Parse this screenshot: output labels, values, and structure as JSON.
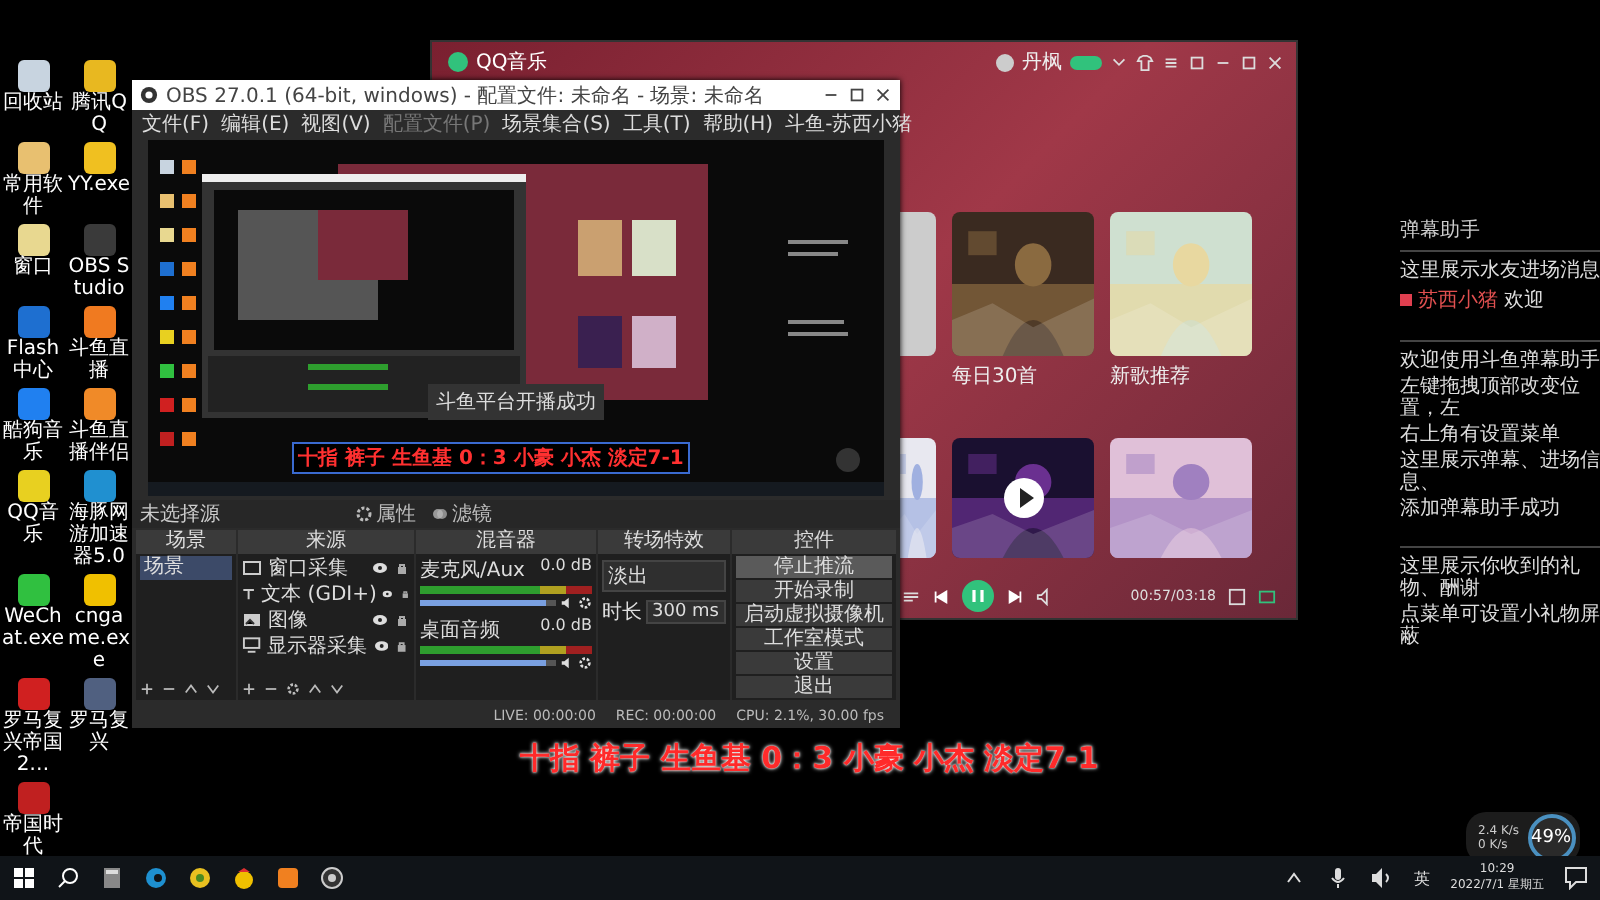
{
  "desktop": {
    "icons": [
      {
        "label": "回收站",
        "color": "#c8d4e0"
      },
      {
        "label": "腾讯QQ",
        "color": "#e8b820"
      },
      {
        "label": "常用软件",
        "color": "#e8c070"
      },
      {
        "label": "YY.exe",
        "color": "#f0c020"
      },
      {
        "label": "窗口",
        "color": "#e8d890"
      },
      {
        "label": "OBS Studio",
        "color": "#3a3a3a"
      },
      {
        "label": "Flash中心",
        "color": "#1e6fd0"
      },
      {
        "label": "斗鱼直播",
        "color": "#f07a20"
      },
      {
        "label": "酷狗音乐",
        "color": "#2080f0"
      },
      {
        "label": "斗鱼直播伴侣",
        "color": "#f08a28"
      },
      {
        "label": "QQ音乐",
        "color": "#e8d020"
      },
      {
        "label": "海豚网游加速器5.0",
        "color": "#2090d0"
      },
      {
        "label": "WeChat.exe",
        "color": "#30c040"
      },
      {
        "label": "cngame.exe",
        "color": "#f0c000"
      },
      {
        "label": "罗马复兴帝国2…",
        "color": "#d02020"
      },
      {
        "label": "罗马复兴",
        "color": "#506080"
      },
      {
        "label": "帝国时代",
        "color": "#c02020"
      }
    ],
    "caption": "十指 裤子 生鱼基 0：3 小豪 小杰 淡定7-1"
  },
  "obs": {
    "title": "OBS 27.0.1 (64-bit, windows) - 配置文件: 未命名 - 场景: 未命名",
    "menu": [
      {
        "label": "文件(F)",
        "disabled": false
      },
      {
        "label": "编辑(E)",
        "disabled": false
      },
      {
        "label": "视图(V)",
        "disabled": false
      },
      {
        "label": "配置文件(P)",
        "disabled": true
      },
      {
        "label": "场景集合(S)",
        "disabled": false
      },
      {
        "label": "工具(T)",
        "disabled": false
      },
      {
        "label": "帮助(H)",
        "disabled": false
      },
      {
        "label": "斗鱼-苏西小猪",
        "disabled": false
      }
    ],
    "preview": {
      "caption": "十指 裤子 生鱼基 0：3 小豪 小杰 淡定7-1",
      "toast": "斗鱼平台开播成功"
    },
    "source_bar": {
      "label": "未选择源",
      "buttons": [
        {
          "label": "属性",
          "kind": "properties"
        },
        {
          "label": "滤镜",
          "kind": "filters"
        }
      ]
    },
    "scenes": {
      "title": "场景",
      "items": [
        {
          "label": "场景",
          "selected": true
        }
      ]
    },
    "sources": {
      "title": "来源",
      "items": [
        {
          "label": "窗口采集",
          "kind": "window"
        },
        {
          "label": "文本 (GDI+)",
          "kind": "text"
        },
        {
          "label": "图像"
        },
        {
          "label": "显示器采集",
          "kind": "monitor"
        }
      ]
    },
    "mixer": {
      "title": "混音器",
      "channels": [
        {
          "name": "麦克风/Aux",
          "reading": "0.0 dB",
          "level": 0.92
        },
        {
          "name": "桌面音频",
          "reading": "0.0 dB",
          "level": 0.92
        }
      ]
    },
    "transitions": {
      "title": "转场特效",
      "type": "淡出",
      "duration_label": "时长",
      "duration": "300 ms"
    },
    "controls": {
      "title": "控件",
      "buttons": [
        {
          "label": "停止推流",
          "selected": true
        },
        {
          "label": "开始录制",
          "selected": false
        },
        {
          "label": "启动虚拟摄像机",
          "selected": false
        },
        {
          "label": "工作室模式",
          "selected": false
        },
        {
          "label": "设置",
          "selected": false
        },
        {
          "label": "退出",
          "selected": false
        }
      ]
    },
    "status": {
      "live": "LIVE: 00:00:00",
      "rec": "REC: 00:00:00",
      "cpu": "CPU: 2.1%, 30.00 fps"
    }
  },
  "qqmusic": {
    "title": "QQ音乐",
    "user": "丹枫",
    "cards": [
      {
        "label": "每日30首",
        "kind": "daily"
      },
      {
        "label": "新歌推荐",
        "kind": "new"
      }
    ],
    "row2": [
      {
        "kind": "anime"
      },
      {
        "kind": "city"
      },
      {
        "kind": "portrait"
      }
    ],
    "player": {
      "playing": true,
      "time": "00:57/03:18"
    }
  },
  "danmu_panel": {
    "title": "弹幕助手",
    "sections": [
      [
        {
          "kind": "note",
          "text": "这里展示水友进场消息"
        },
        {
          "kind": "entry",
          "user": "苏西小猪",
          "text": "欢迎"
        }
      ],
      [
        {
          "kind": "note",
          "text": "欢迎使用斗鱼弹幕助手"
        },
        {
          "kind": "note",
          "text": "左键拖拽顶部改变位置，左"
        },
        {
          "kind": "note",
          "text": "右上角有设置菜单"
        },
        {
          "kind": "note",
          "text": "这里展示弹幕、进场信息、"
        },
        {
          "kind": "note",
          "text": "添加弹幕助手成功"
        }
      ],
      [
        {
          "kind": "note",
          "text": "这里展示你收到的礼物、酬谢"
        },
        {
          "kind": "note",
          "text": "点菜单可设置小礼物屏蔽"
        }
      ]
    ]
  },
  "net_widget": {
    "up": "2.4 K/s",
    "down": "0 K/s",
    "percent": "49%"
  },
  "taskbar": {
    "ime": "英",
    "time": "10:29",
    "date": "2022/7/1 星期五"
  }
}
